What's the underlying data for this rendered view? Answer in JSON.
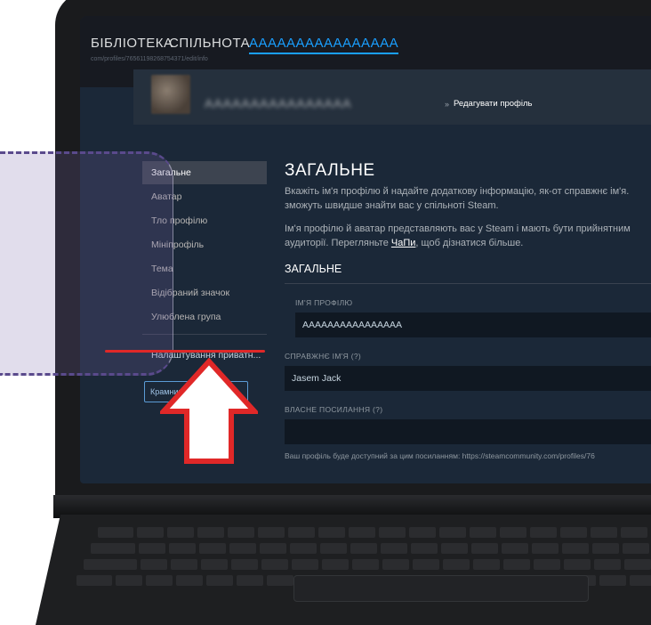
{
  "nav": {
    "library": "БІБЛІОТЕКА",
    "community": "СПІЛЬНОТА",
    "username": "АААААААААААААААА",
    "url": "com/profiles/76561198268754371/edit/info"
  },
  "profile_bar": {
    "username": "АААААААААААААААА",
    "separator": "»",
    "page": "Редагувати профіль"
  },
  "sidebar": {
    "items": [
      {
        "label": "Загальне"
      },
      {
        "label": "Аватар"
      },
      {
        "label": "Тло профілю"
      },
      {
        "label": "Мініпрофіль"
      },
      {
        "label": "Тема"
      },
      {
        "label": "Відібраний значок"
      },
      {
        "label": "Улюблена група"
      }
    ],
    "privacy": "Налаштування приватн...",
    "shop_button": "Крамниця очок Steam"
  },
  "main": {
    "heading": "ЗАГАЛЬНЕ",
    "desc1_line1": "Вкажіть ім'я профілю й надайте додаткову інформацію, як-от справжнє ім'я.",
    "desc1_line2": "зможуть швидше знайти вас у спільноті Steam.",
    "desc2_line1": "Ім'я профілю й аватар представляють вас у Steam і мають бути прийнятним",
    "desc2_line2_a": "аудиторії. Перегляньте ",
    "desc2_link": "ЧаПи",
    "desc2_line2_b": ", щоб дізнатися більше.",
    "sub_heading": "ЗАГАЛЬНЕ",
    "profile_name_label": "ІМ'Я ПРОФІЛЮ",
    "profile_name_value": "АААААААААААААААА",
    "real_name_label": "СПРАВЖНЄ ІМ'Я (?)",
    "real_name_value": "Jasem Jack",
    "custom_url_label": "ВЛАСНЕ ПОСИЛАННЯ (?)",
    "custom_url_value": "",
    "custom_url_note": "Ваш профіль буде доступний за цим посиланням: https://steamcommunity.com/profiles/76"
  },
  "colors": {
    "accent": "#1a9fff",
    "highlight_line": "#e02828",
    "arrow": "#e02828",
    "overlay": "#7664aa"
  }
}
